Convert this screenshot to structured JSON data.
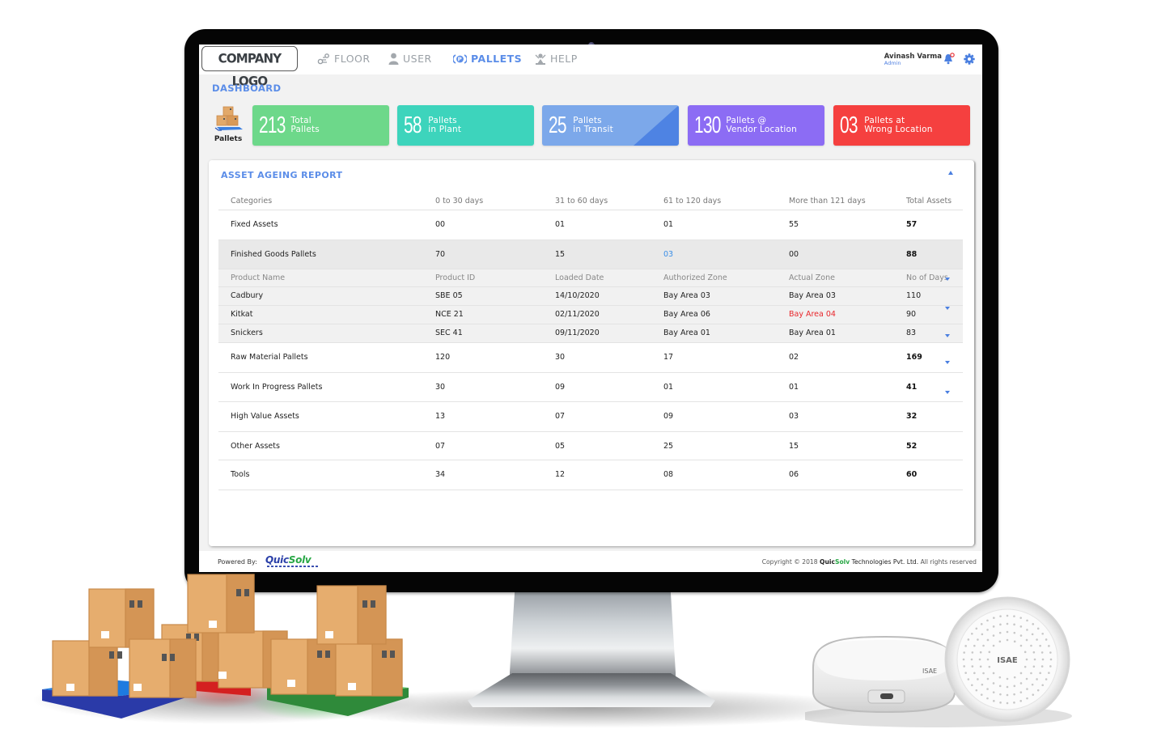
{
  "header": {
    "logo_text": "COMPANY LOGO",
    "nav": [
      {
        "label": "FLOOR",
        "icon": "floor-map-icon",
        "active": false
      },
      {
        "label": "USER",
        "icon": "user-icon",
        "active": false
      },
      {
        "label": "PALLETS",
        "icon": "pallets-p-icon",
        "active": true
      },
      {
        "label": "HELP",
        "icon": "help-icon",
        "active": false
      }
    ],
    "user_name": "Avinash Varma",
    "user_role": "Admin",
    "bell_icon": "bell-icon",
    "settings_icon": "gear-icon"
  },
  "breadcrumb": "DASHBOARD",
  "summary": {
    "badge_label": "Pallets",
    "cards": [
      {
        "value": "213",
        "line1": "Total",
        "line2": "Pallets",
        "color": "#6dd88a"
      },
      {
        "value": "58",
        "line1": "Pallets",
        "line2": "in Plant",
        "color": "#3dd4bc"
      },
      {
        "value": "25",
        "line1": "Pallets",
        "line2": "in Transit",
        "color": "#7ca8ea"
      },
      {
        "value": "130",
        "line1": "Pallets @",
        "line2": "Vendor Location",
        "color": "#8c6cf4"
      },
      {
        "value": "03",
        "line1": "Pallets at",
        "line2": "Wrong Location",
        "color": "#f5403f"
      }
    ]
  },
  "report": {
    "title": "ASSET AGEING REPORT",
    "columns": [
      "Categories",
      "0 to 30 days",
      "31 to 60 days",
      "61 to 120 days",
      "More than 121 days",
      "Total Assets"
    ],
    "rows": [
      {
        "category": "Fixed Assets",
        "d0_30": "00",
        "d31_60": "01",
        "d61_120": "01",
        "d121_plus": "55",
        "total": "57"
      },
      {
        "category": "Finished Goods Pallets",
        "d0_30": "70",
        "d31_60": "15",
        "d61_120": "03",
        "d121_plus": "00",
        "total": "88",
        "expanded": true
      },
      {
        "category": "Raw Material Pallets",
        "d0_30": "120",
        "d31_60": "30",
        "d61_120": "17",
        "d121_plus": "02",
        "total": "169"
      },
      {
        "category": "Work In Progress Pallets",
        "d0_30": "30",
        "d31_60": "09",
        "d61_120": "01",
        "d121_plus": "01",
        "total": "41"
      },
      {
        "category": "High Value Assets",
        "d0_30": "13",
        "d31_60": "07",
        "d61_120": "09",
        "d121_plus": "03",
        "total": "32"
      },
      {
        "category": "Other Assets",
        "d0_30": "07",
        "d31_60": "05",
        "d61_120": "25",
        "d121_plus": "15",
        "total": "52"
      },
      {
        "category": "Tools",
        "d0_30": "34",
        "d31_60": "12",
        "d61_120": "08",
        "d121_plus": "06",
        "total": "60"
      }
    ],
    "detail": {
      "columns": [
        "Product Name",
        "Product ID",
        "Loaded Date",
        "Authorized Zone",
        "Actual Zone",
        "No of Days"
      ],
      "rows": [
        {
          "product": "Cadbury",
          "id": "SBE 05",
          "loaded": "14/10/2020",
          "authorized": "Bay Area 03",
          "actual": "Bay Area 03",
          "days": "110",
          "mismatch": false
        },
        {
          "product": "Kitkat",
          "id": "NCE 21",
          "loaded": "02/11/2020",
          "authorized": "Bay Area 06",
          "actual": "Bay Area 04",
          "days": "90",
          "mismatch": true
        },
        {
          "product": "Snickers",
          "id": "SEC 41",
          "loaded": "09/11/2020",
          "authorized": "Bay Area 01",
          "actual": "Bay Area 01",
          "days": "83",
          "mismatch": false
        }
      ]
    }
  },
  "footer": {
    "powered_by": "Powered By:",
    "brand_part1": "Quic",
    "brand_part2": "Solv",
    "copyright_pre": "Copyright © 2018",
    "copyright_brand1": "Quic",
    "copyright_brand2": "Solv",
    "copyright_company": "Technologies Pvt. Ltd.",
    "copyright_post": "All rights reserved"
  },
  "decor": {
    "device_brand": "ISAE"
  }
}
